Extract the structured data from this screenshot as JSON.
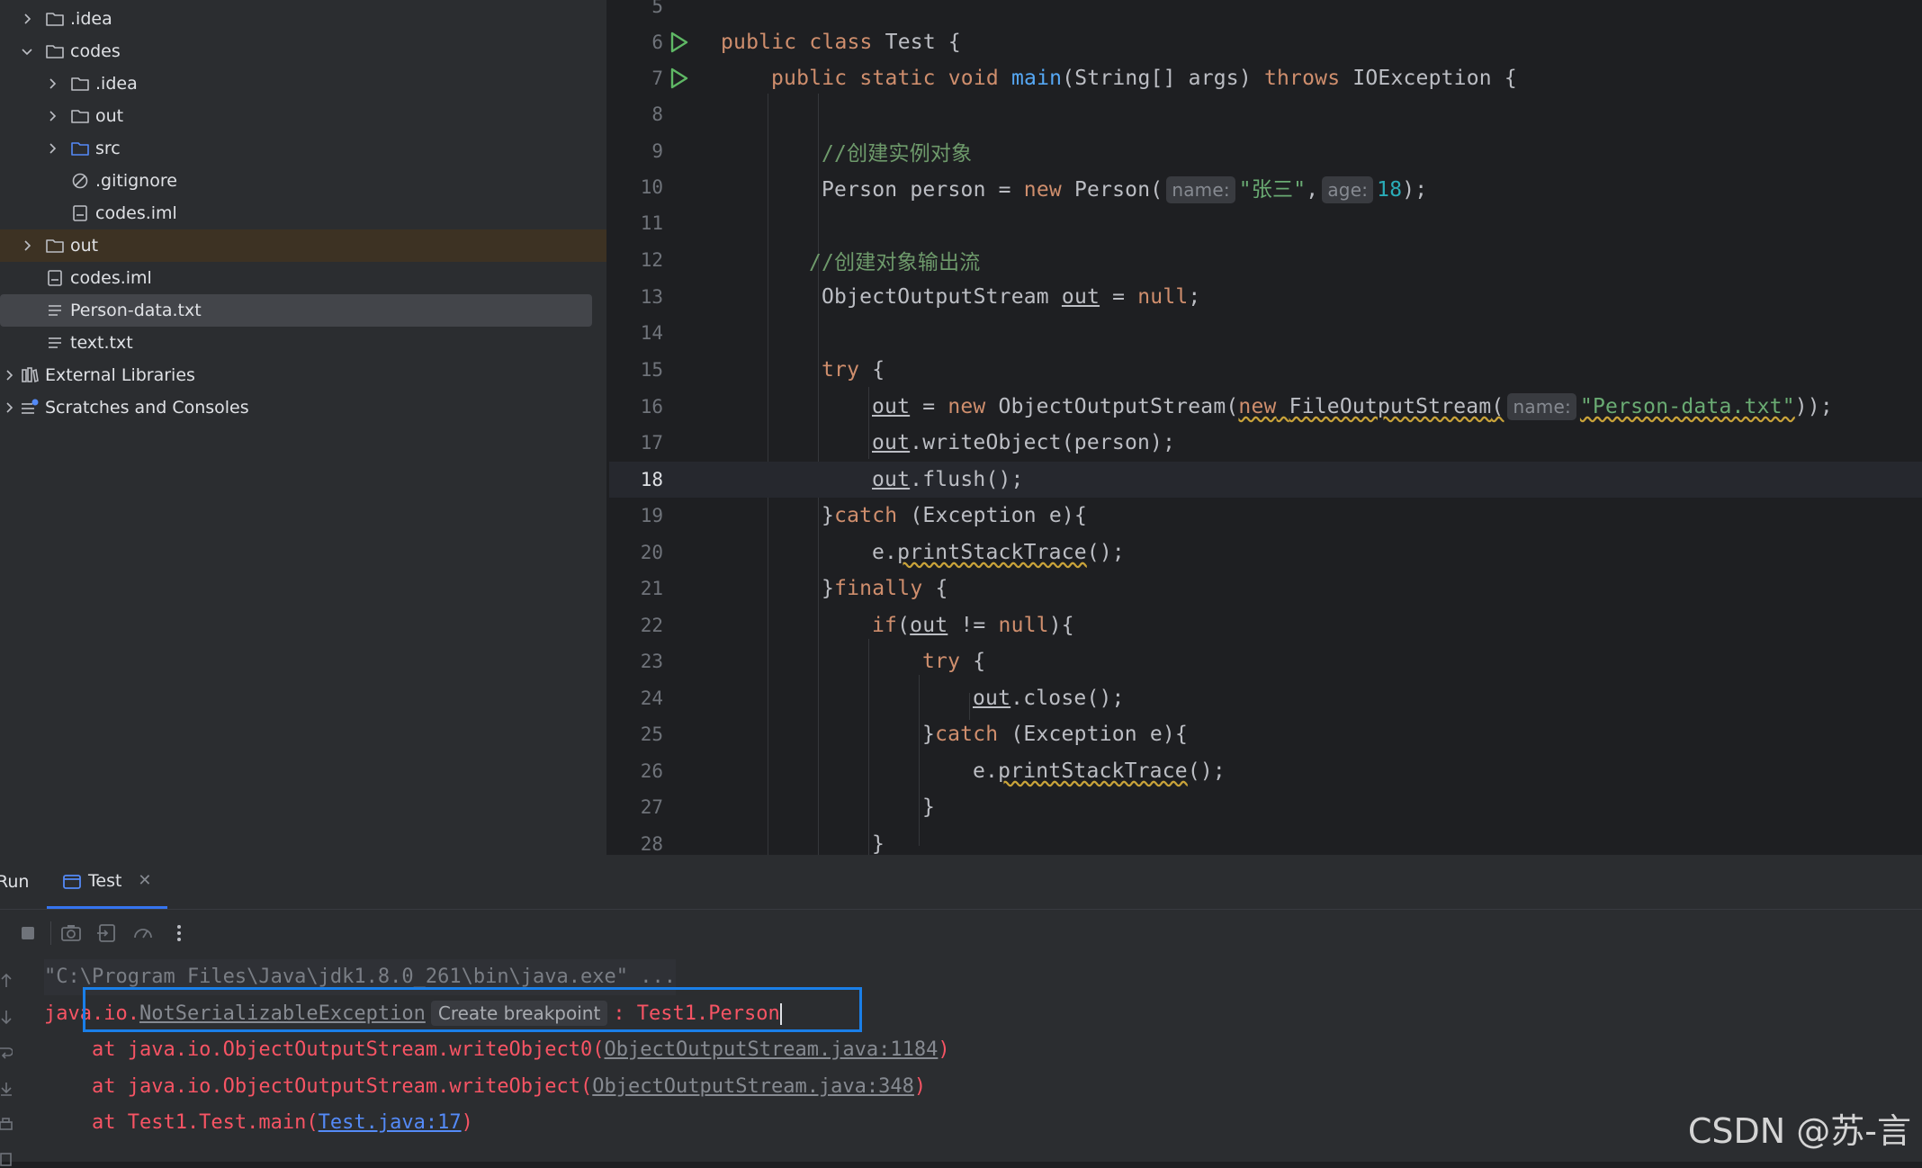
{
  "project_tree": {
    "items": [
      {
        "label": ".idea",
        "kind": "folder",
        "depth": 1,
        "expanded": false
      },
      {
        "label": "codes",
        "kind": "folder",
        "depth": 1,
        "expanded": true
      },
      {
        "label": ".idea",
        "kind": "folder",
        "depth": 2,
        "expanded": false
      },
      {
        "label": "out",
        "kind": "folder",
        "depth": 2,
        "expanded": false
      },
      {
        "label": "src",
        "kind": "source-folder",
        "depth": 2,
        "expanded": false
      },
      {
        "label": ".gitignore",
        "kind": "ignore-file",
        "depth": 2
      },
      {
        "label": "codes.iml",
        "kind": "iml-file",
        "depth": 2
      },
      {
        "label": "out",
        "kind": "folder",
        "depth": 1,
        "expanded": false,
        "highlighted": true
      },
      {
        "label": "codes.iml",
        "kind": "iml-file",
        "depth": 1
      },
      {
        "label": "Person-data.txt",
        "kind": "text-file",
        "depth": 1,
        "selected": true
      },
      {
        "label": "text.txt",
        "kind": "text-file",
        "depth": 1
      },
      {
        "label": "External Libraries",
        "kind": "libraries",
        "depth": 0
      },
      {
        "label": "Scratches and Consoles",
        "kind": "scratches",
        "depth": 0
      }
    ]
  },
  "editor": {
    "current_line": 18,
    "line_numbers": [
      "5",
      "6",
      "7",
      "8",
      "9",
      "10",
      "11",
      "12",
      "13",
      "14",
      "15",
      "16",
      "17",
      "18",
      "19",
      "20",
      "21",
      "22",
      "23",
      "24",
      "25",
      "26",
      "27",
      "28"
    ],
    "tokens": {
      "public": "public",
      "class": "class",
      "static": "static",
      "void": "void",
      "test": "Test",
      "main": "main",
      "string_args": "(String[] args) ",
      "throws": "throws",
      "ioexception": " IOException {",
      "comment1": "//创建实例对象",
      "comment2": "//创建对象输出流",
      "person_decl": "Person person = ",
      "new": "new",
      "person_ctor": " Person(",
      "hint_name": "name:",
      "hint_age": "age:",
      "zhangsan": "\"张三\"",
      "comma": ",",
      "eighteen": "18",
      "close_paren_semi": ");",
      "oos_decl": "ObjectOutputStream ",
      "out": "out",
      "eq": " = ",
      "null": "null",
      "semi": ";",
      "try": "try",
      "brace_open": " {",
      "oos_new": " ObjectOutputStream(",
      "fos": "FileOutputStream",
      "paren_open": "(",
      "person_file": "\"Person-data.txt\"",
      "close_paren2": "));",
      "write_object": ".writeObject(person);",
      "flush": ".flush();",
      "catch_close": "}",
      "catch": "catch",
      "catch_tail": " (Exception e){",
      "e_dot": "e.",
      "print_stack": "printStackTrace",
      "paren_semi": "();",
      "finally": "finally",
      "if": "if",
      "not_eq": " != ",
      "close_brace_paren": "){",
      "close_call": ".close();",
      "close_brace": "}",
      "space": " "
    }
  },
  "run_panel": {
    "title": "Run",
    "tab_label": "Test",
    "console": {
      "command": "\"C:\\Program Files\\Java\\jdk1.8.0_261\\bin\\java.exe\" ...",
      "exception_prefix": "java.io.",
      "exception_name": "NotSerializableException",
      "breakpoint_hint": "Create breakpoint",
      "exception_suffix": ": Test1.Person",
      "trace": [
        {
          "prefix": "    at java.io.ObjectOutputStream.writeObject0(",
          "link": "ObjectOutputStream.java:1184",
          "suffix": ")",
          "link_style": "gray"
        },
        {
          "prefix": "    at java.io.ObjectOutputStream.writeObject(",
          "link": "ObjectOutputStream.java:348",
          "suffix": ")",
          "link_style": "gray"
        },
        {
          "prefix": "    at Test1.Test.main(",
          "link": "Test.java:17",
          "suffix": ")",
          "link_style": "blue"
        }
      ]
    }
  },
  "watermark": "CSDN @苏-言",
  "colors": {
    "keyword": "#cf8e6d",
    "function": "#56a8f5",
    "string": "#6aab73",
    "number": "#2aacb8",
    "error": "#f75464",
    "link": "#548af7",
    "highlight_box": "#1a7fe8",
    "run_icon": "#5fb865"
  }
}
